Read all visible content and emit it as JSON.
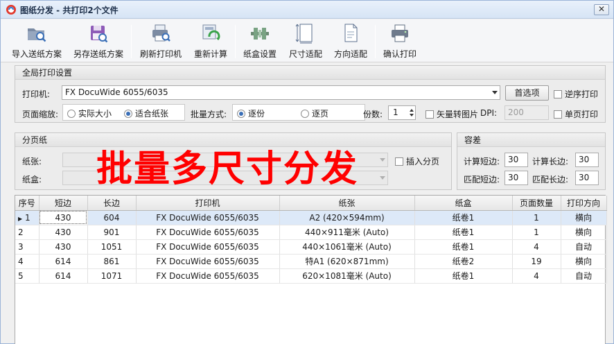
{
  "window": {
    "title": "图纸分发 - 共打印2个文件",
    "close_glyph": "✕"
  },
  "toolbar": {
    "buttons": [
      {
        "label": "导入送纸方案",
        "icon": "folder-search-icon"
      },
      {
        "label": "另存送纸方案",
        "icon": "save-disk-icon"
      },
      {
        "label": "刷新打印机",
        "icon": "printer-search-icon"
      },
      {
        "label": "重新计算",
        "icon": "recalculate-icon"
      },
      {
        "label": "纸盒设置",
        "icon": "tray-settings-icon"
      },
      {
        "label": "尺寸适配",
        "icon": "size-fit-icon"
      },
      {
        "label": "方向适配",
        "icon": "orientation-fit-icon"
      },
      {
        "label": "确认打印",
        "icon": "printer-icon"
      }
    ]
  },
  "global": {
    "title": "全局打印设置",
    "printer_label": "打印机:",
    "printer_value": "FX DocuWide 6055/6035",
    "preferences_button": "首选项",
    "reverse_print": "逆序打印",
    "scale_label": "页面缩放:",
    "scale_actual": "实际大小",
    "scale_fit": "适合纸张",
    "batch_label": "批量方式:",
    "batch_copy": "逐份",
    "batch_page": "逐页",
    "copies_label": "份数:",
    "copies_value": "1",
    "vector_to_image": "矢量转图片",
    "dpi_label": "DPI:",
    "dpi_value": "200",
    "single_page": "单页打印"
  },
  "paging": {
    "title": "分页纸",
    "paper_label": "纸张:",
    "tray_label": "纸盒:",
    "insert_page": "插入分页"
  },
  "tolerance": {
    "title": "容差",
    "calc_short_label": "计算短边:",
    "calc_short_value": "30",
    "calc_long_label": "计算长边:",
    "calc_long_value": "30",
    "match_short_label": "匹配短边:",
    "match_short_value": "30",
    "match_long_label": "匹配长边:",
    "match_long_value": "30"
  },
  "overlay_text": "批量多尺寸分发",
  "table": {
    "headers": [
      "序号",
      "短边",
      "长边",
      "打印机",
      "纸张",
      "纸盒",
      "页面数量",
      "打印方向"
    ],
    "rows": [
      {
        "idx": "1",
        "short": "430",
        "long": "604",
        "printer": "FX DocuWide 6055/6035",
        "paper": "A2 (420×594mm)",
        "tray": "纸卷1",
        "pages": "1",
        "orient": "横向"
      },
      {
        "idx": "2",
        "short": "430",
        "long": "901",
        "printer": "FX DocuWide 6055/6035",
        "paper": "440×911毫米 (Auto)",
        "tray": "纸卷1",
        "pages": "1",
        "orient": "横向"
      },
      {
        "idx": "3",
        "short": "430",
        "long": "1051",
        "printer": "FX DocuWide 6055/6035",
        "paper": "440×1061毫米 (Auto)",
        "tray": "纸卷1",
        "pages": "4",
        "orient": "自动"
      },
      {
        "idx": "4",
        "short": "614",
        "long": "861",
        "printer": "FX DocuWide 6055/6035",
        "paper": "特A1 (620×871mm)",
        "tray": "纸卷2",
        "pages": "19",
        "orient": "横向"
      },
      {
        "idx": "5",
        "short": "614",
        "long": "1071",
        "printer": "FX DocuWide 6055/6035",
        "paper": "620×1081毫米 (Auto)",
        "tray": "纸卷1",
        "pages": "4",
        "orient": "自动"
      }
    ]
  },
  "colors": {
    "accent": "#3a6fb7",
    "overlay": "#ff0000",
    "selected_row": "#dde9f8"
  }
}
